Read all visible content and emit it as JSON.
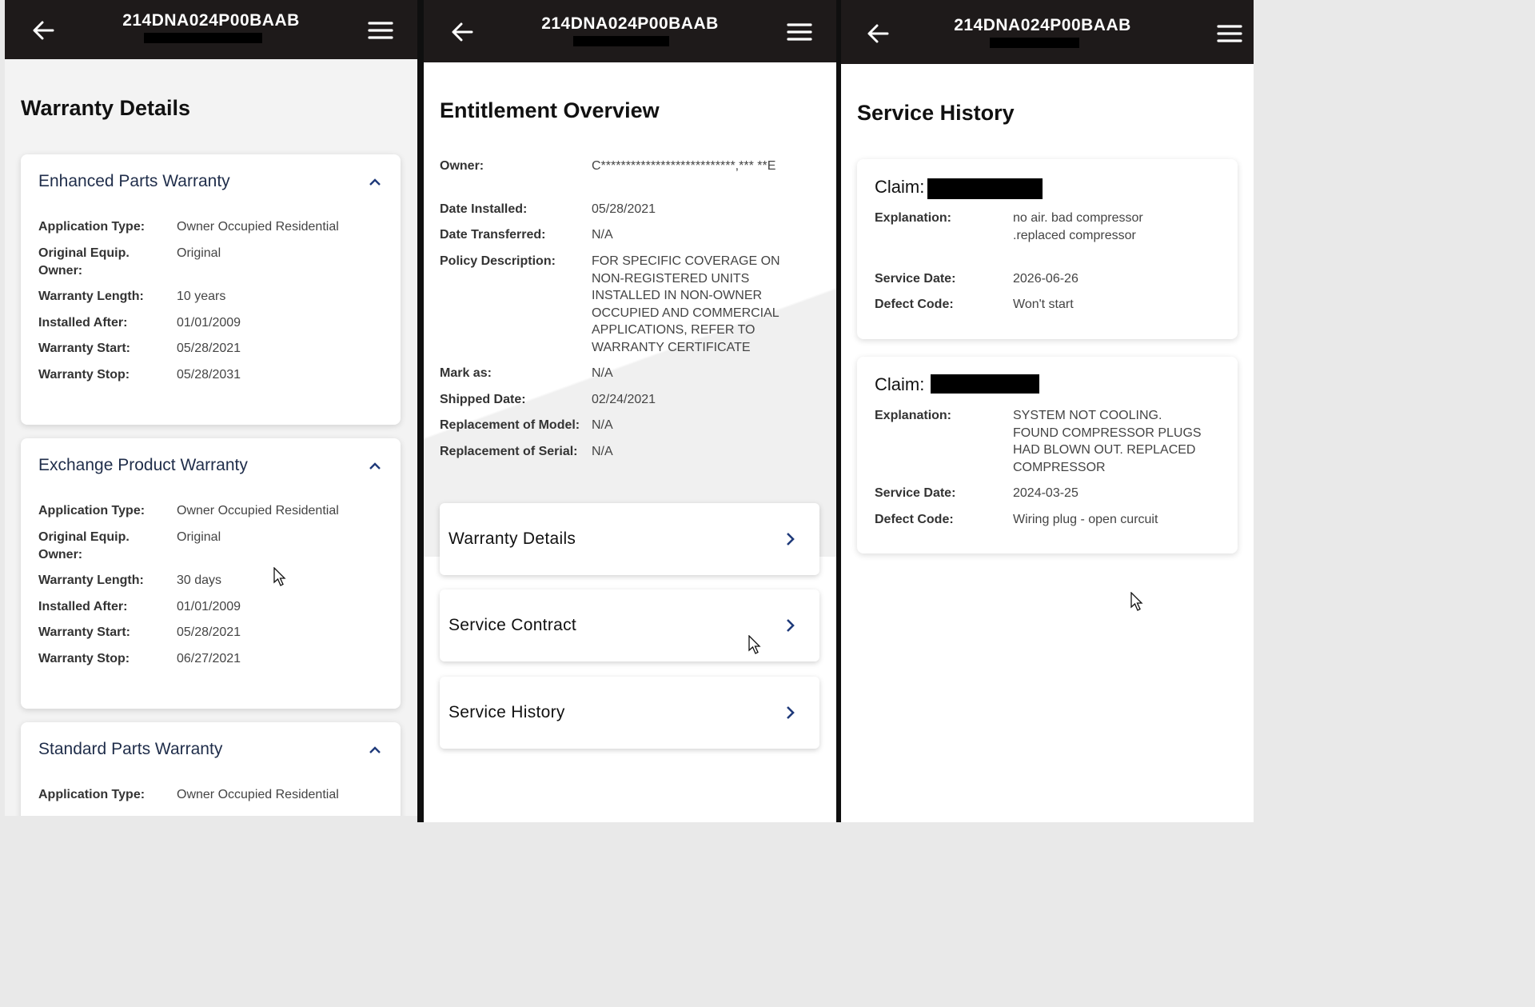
{
  "header": {
    "serial": "214DNA024P00BAAB"
  },
  "warranty": {
    "title": "Warranty Details",
    "cards": [
      {
        "title": "Enhanced Parts Warranty",
        "rows": [
          {
            "k": "Application Type:",
            "v": "Owner Occupied Residential"
          },
          {
            "k": "Original Equip. Owner:",
            "v": "Original"
          },
          {
            "k": "Warranty Length:",
            "v": "10 years"
          },
          {
            "k": "Installed After:",
            "v": "01/01/2009"
          },
          {
            "k": "Warranty Start:",
            "v": "05/28/2021"
          },
          {
            "k": "Warranty Stop:",
            "v": "05/28/2031"
          }
        ]
      },
      {
        "title": "Exchange Product Warranty",
        "rows": [
          {
            "k": "Application Type:",
            "v": "Owner Occupied Residential"
          },
          {
            "k": "Original Equip. Owner:",
            "v": "Original"
          },
          {
            "k": "Warranty Length:",
            "v": "30 days"
          },
          {
            "k": "Installed After:",
            "v": "01/01/2009"
          },
          {
            "k": "Warranty Start:",
            "v": "05/28/2021"
          },
          {
            "k": "Warranty Stop:",
            "v": "06/27/2021"
          }
        ]
      },
      {
        "title": "Standard Parts Warranty",
        "rows": [
          {
            "k": "Application Type:",
            "v": "Owner Occupied Residential"
          }
        ]
      }
    ]
  },
  "entitlement": {
    "title": "Entitlement Overview",
    "rows": [
      {
        "k": "Owner:",
        "v": "C***************************,*** **E"
      },
      {
        "k": "Date Installed:",
        "v": "05/28/2021"
      },
      {
        "k": "Date Transferred:",
        "v": "N/A"
      },
      {
        "k": "Policy Description:",
        "v": "FOR SPECIFIC COVERAGE ON NON-REGISTERED UNITS INSTALLED IN NON-OWNER OCCUPIED AND COMMERCIAL APPLICATIONS, REFER TO WARRANTY CERTIFICATE"
      },
      {
        "k": "Mark as:",
        "v": "N/A"
      },
      {
        "k": "Shipped Date:",
        "v": "02/24/2021"
      },
      {
        "k": "Replacement of Model:",
        "v": "N/A"
      },
      {
        "k": "Replacement of Serial:",
        "v": "N/A"
      }
    ],
    "nav": [
      {
        "label": "Warranty Details"
      },
      {
        "label": "Service Contract"
      },
      {
        "label": "Service History"
      }
    ]
  },
  "history": {
    "title": "Service History",
    "claims": [
      {
        "label": "Claim:",
        "rows": [
          {
            "k": "Explanation:",
            "v": "no air. bad compressor .replaced compressor"
          },
          {
            "k": "Service Date:",
            "v": "2026-06-26"
          },
          {
            "k": "Defect Code:",
            "v": "Won't start"
          }
        ]
      },
      {
        "label": "Claim:",
        "rows": [
          {
            "k": "Explanation:",
            "v": "SYSTEM NOT COOLING. FOUND COMPRESSOR PLUGS HAD BLOWN OUT. REPLACED COMPRESSOR"
          },
          {
            "k": "Service Date:",
            "v": "2024-03-25"
          },
          {
            "k": "Defect Code:",
            "v": "Wiring plug - open curcuit"
          }
        ]
      }
    ]
  }
}
